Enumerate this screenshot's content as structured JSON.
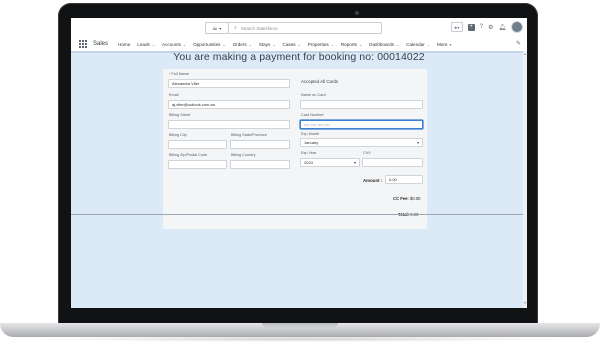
{
  "search": {
    "scope": "All",
    "placeholder": "Search Salesforce"
  },
  "app": {
    "name": "Sales"
  },
  "nav": {
    "items": [
      {
        "label": "Home",
        "chevron": false
      },
      {
        "label": "Leads",
        "chevron": true
      },
      {
        "label": "Accounts",
        "chevron": true
      },
      {
        "label": "Opportunities",
        "chevron": true
      },
      {
        "label": "Orders",
        "chevron": true
      },
      {
        "label": "Stays",
        "chevron": true
      },
      {
        "label": "Cases",
        "chevron": true
      },
      {
        "label": "Properties",
        "chevron": true
      },
      {
        "label": "Reports",
        "chevron": true
      },
      {
        "label": "Dashboards",
        "chevron": true
      },
      {
        "label": "Calendar",
        "chevron": true
      },
      {
        "label": "More",
        "chevron": true
      }
    ]
  },
  "page": {
    "title": "You are making a payment for booking no: 00014022"
  },
  "form": {
    "full_name": {
      "label": "Full Name",
      "required_mark": "*",
      "value": "Alexandra Viter"
    },
    "email": {
      "label": "Email",
      "value": "aj.viter@outlook.com.au"
    },
    "billing_street": {
      "label": "Billing Street",
      "value": ""
    },
    "billing_city": {
      "label": "Billing City",
      "value": ""
    },
    "billing_state": {
      "label": "Billing State/Province",
      "value": ""
    },
    "billing_zip": {
      "label": "Billing Zip/Postal Code",
      "value": ""
    },
    "billing_country": {
      "label": "Billing Country",
      "value": ""
    },
    "accepted_cards": "Accepted All Cards",
    "name_on_card": {
      "label": "Name on Card",
      "value": ""
    },
    "card_number": {
      "label": "Card Number",
      "placeholder": "•••• •••• •••• ••••"
    },
    "exp_month": {
      "label": "Exp Month",
      "value": "January"
    },
    "exp_year": {
      "label": "Exp Year",
      "value": "2024"
    },
    "cvv": {
      "label": "CVV",
      "value": ""
    },
    "amount": {
      "label": "Amount",
      "value": "0.00"
    },
    "cc_fee": {
      "label": "CC Fee:",
      "value": "$0.00"
    },
    "total": {
      "label": "Total:",
      "value": "0.00"
    }
  }
}
